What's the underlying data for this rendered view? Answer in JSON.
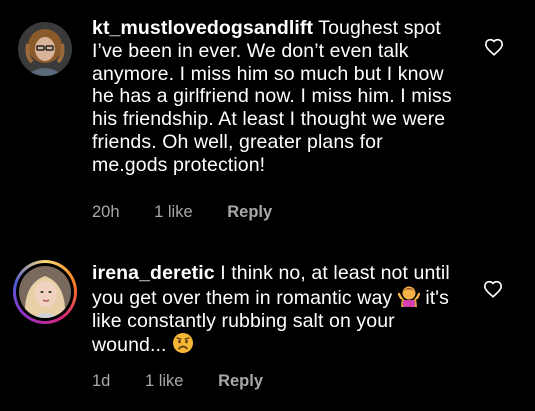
{
  "comments": [
    {
      "username": "kt_mustlovedogsandlift",
      "text": "Toughest spot I’ve been in ever. We don’t even talk anymore. I miss him so much but I know he has a girlfriend now. I miss him. I miss his friendship. At least I thought we were friends. Oh well, greater plans for me.gods protection!",
      "time": "20h",
      "likes": "1 like",
      "reply_label": "Reply",
      "avatar_icon": "user-avatar-curly-hair",
      "like_icon": "heart-outline-icon"
    },
    {
      "username": "irena_deretic",
      "text_part1": "I think no, at least not until you get over them in romantic way",
      "emoji1": "woman-shrugging-emoji",
      "text_part2": "it's like constantly rubbing salt on your wound...",
      "emoji2": "sad-face-emoji",
      "time": "1d",
      "likes": "1 like",
      "reply_label": "Reply",
      "avatar_icon": "user-avatar-blonde",
      "like_icon": "heart-outline-icon"
    }
  ]
}
